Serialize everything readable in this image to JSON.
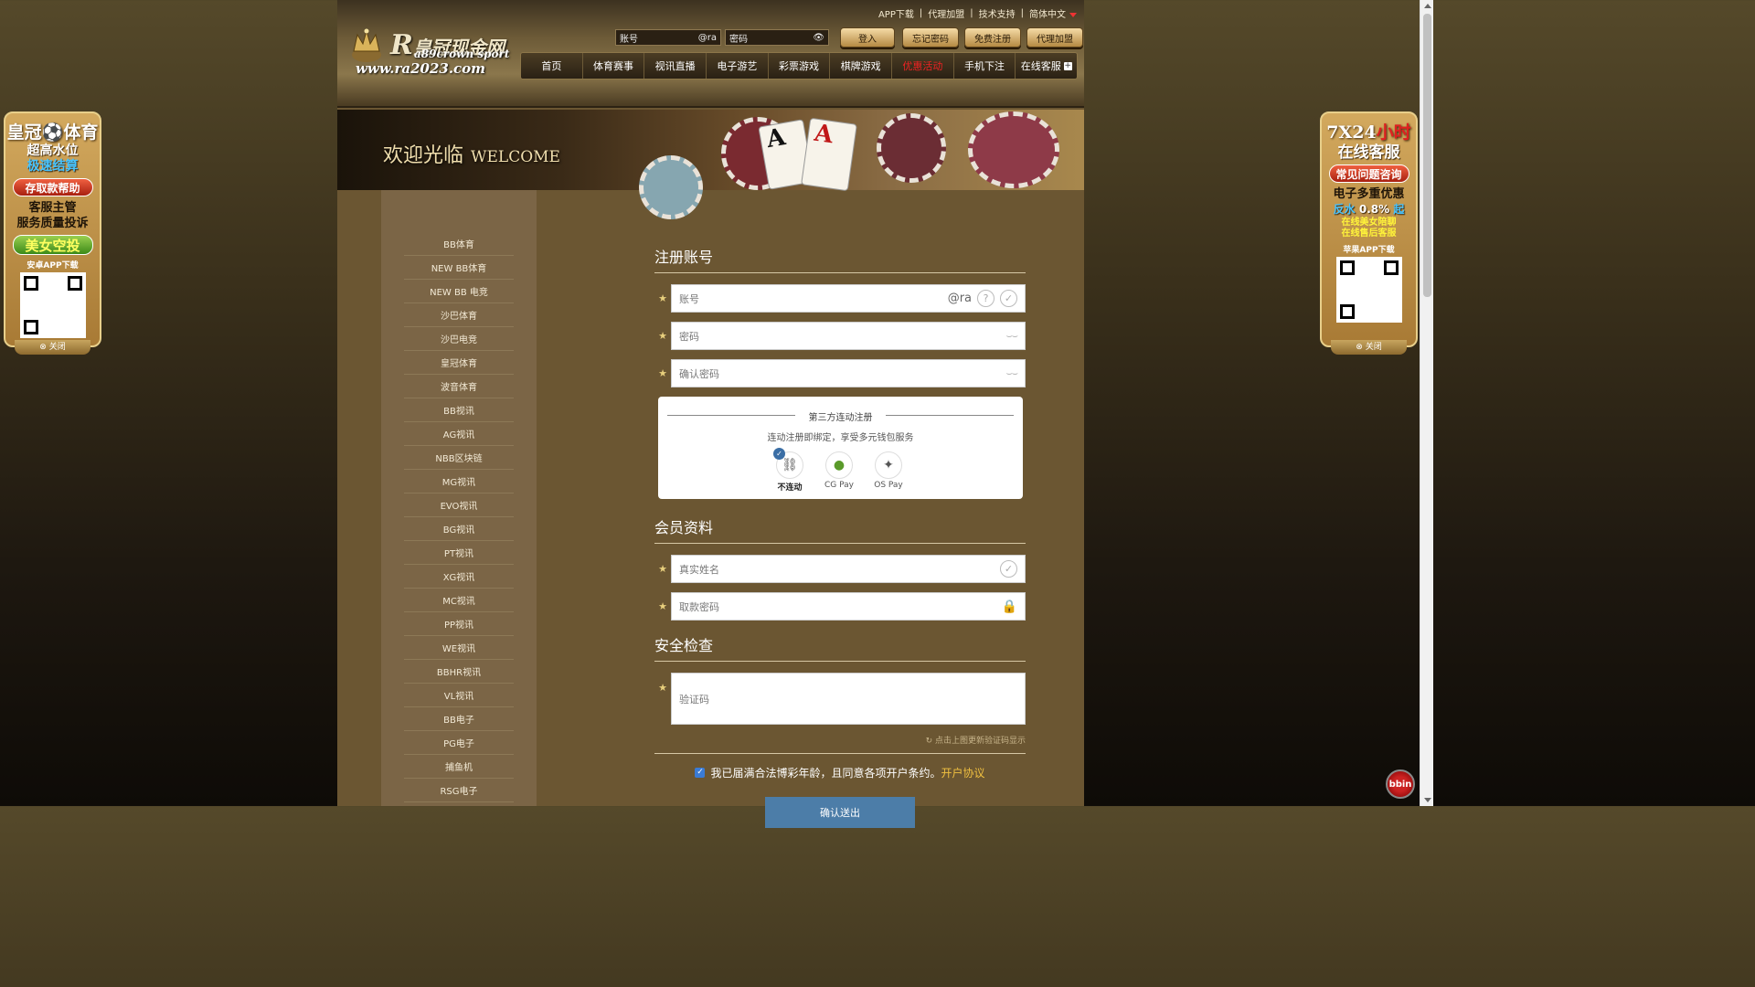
{
  "brand": {
    "name": "皇冠现金网",
    "letter": "R",
    "sub": "a89crown sport",
    "url": "www.ra2023.com"
  },
  "toplinks": [
    "APP下载",
    "代理加盟",
    "技术支持",
    "简体中文"
  ],
  "login": {
    "account_placeholder": "账号",
    "account_suffix": "@ra",
    "password_placeholder": "密码",
    "login_button": "登入",
    "forgot_button": "忘记密码",
    "register_button": "免费注册",
    "agent_button": "代理加盟"
  },
  "nav": [
    "首页",
    "体育赛事",
    "视讯直播",
    "电子游艺",
    "彩票游戏",
    "棋牌游戏",
    "优惠活动",
    "手机下注",
    "在线客服"
  ],
  "banner": {
    "title": "欢迎光临",
    "title_en": "WELCOME"
  },
  "sidebar": [
    "BB体育",
    "NEW BB体育",
    "NEW BB 电竞",
    "沙巴体育",
    "沙巴电竞",
    "皇冠体育",
    "波音体育",
    "BB视讯",
    "AG视讯",
    "NBB区块链",
    "MG视讯",
    "EVO视讯",
    "BG视讯",
    "PT视讯",
    "XG视讯",
    "MC视讯",
    "PP视讯",
    "WE视讯",
    "BBHR视讯",
    "VL视讯",
    "BB电子",
    "PG电子",
    "捕鱼机",
    "RSG电子"
  ],
  "form": {
    "section_account": "注册账号",
    "account_placeholder": "账号",
    "account_suffix": "@ra",
    "help_icon_text": "?",
    "password_placeholder": "密码",
    "confirm_placeholder": "确认密码",
    "third_title": "第三方连动注册",
    "third_desc": "连动注册即绑定，享受多元钱包服务",
    "pay_options": [
      "不连动",
      "CG Pay",
      "OS Pay"
    ],
    "section_member": "会员资料",
    "realname_placeholder": "真实姓名",
    "withdraw_placeholder": "取款密码",
    "section_security": "安全检查",
    "captcha_placeholder": "验证码",
    "refresh_hint": "点击上图更新验证码显示",
    "agree_text": "我已届满合法博彩年龄，且同意各项开户条约。",
    "agree_link": "开户协议",
    "submit": "确认送出"
  },
  "float_left": {
    "title": "皇冠",
    "title2": "体育",
    "line1": "超高水位",
    "line2": "极速结算",
    "pill": "存取款帮助",
    "line3": "客服主管",
    "line4": "服务质量投诉",
    "pill2": "美女空投",
    "qr_label": "安卓APP下载",
    "close": "关闭"
  },
  "float_right": {
    "title": "7X24",
    "title_red": "小时",
    "line1": "在线客服",
    "pill": "常见问题咨询",
    "line2": "电子多重优惠",
    "line3a": "反水",
    "line3b": "0.8%",
    "line3c": "起",
    "line4": "在线美女陪聊",
    "line5": "在线售后客服",
    "qr_label": "苹果APP下载",
    "close": "关闭"
  },
  "bbin": "bbin",
  "colors": {
    "accent": "#e8cf7d",
    "submit": "#4c7da8",
    "link": "#f0c040",
    "hot_nav": "#e22222"
  }
}
